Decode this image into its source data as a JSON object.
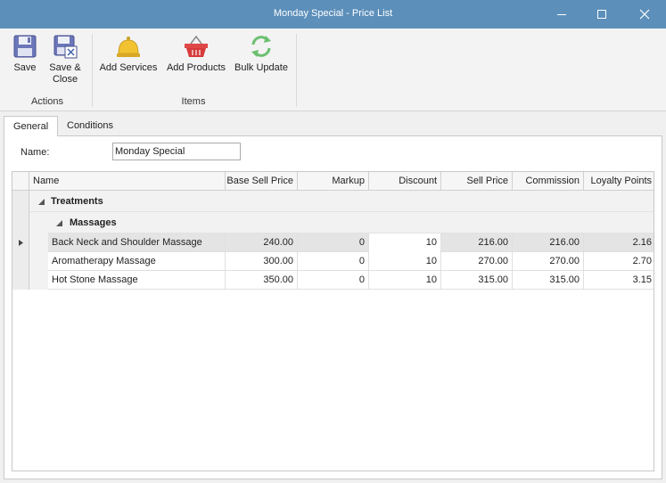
{
  "window": {
    "title": "Monday Special - Price List",
    "controls": [
      "minimize-icon",
      "maximize-icon",
      "close-icon"
    ]
  },
  "ribbon": {
    "groups": [
      {
        "label": "Actions",
        "buttons": [
          {
            "label": "Save",
            "icon": "floppy-disk-icon"
          },
          {
            "label_line1": "Save &",
            "label_line2": "Close",
            "icon": "save-close-icon"
          }
        ]
      },
      {
        "label": "Items",
        "buttons": [
          {
            "label": "Add Services",
            "icon": "service-bell-icon"
          },
          {
            "label": "Add Products",
            "icon": "shopping-basket-icon"
          },
          {
            "label": "Bulk Update",
            "icon": "refresh-icon"
          }
        ]
      }
    ]
  },
  "tabs": [
    {
      "label": "General",
      "active": true
    },
    {
      "label": "Conditions",
      "active": false
    }
  ],
  "form": {
    "name_label": "Name:",
    "name_value": "Monday Special"
  },
  "grid": {
    "columns": [
      "Name",
      "Base Sell Price",
      "Markup",
      "Discount",
      "Sell Price",
      "Commission",
      "Loyalty Points"
    ],
    "group": "Treatments",
    "subgroup": "Massages",
    "rows": [
      {
        "name": "Back Neck and Shoulder Massage",
        "base": "240.00",
        "markup": "0",
        "discount": "10",
        "sell": "216.00",
        "commission": "216.00",
        "loyalty": "2.16"
      },
      {
        "name": "Aromatherapy Massage",
        "base": "300.00",
        "markup": "0",
        "discount": "10",
        "sell": "270.00",
        "commission": "270.00",
        "loyalty": "2.70"
      },
      {
        "name": "Hot Stone Massage",
        "base": "350.00",
        "markup": "0",
        "discount": "10",
        "sell": "315.00",
        "commission": "315.00",
        "loyalty": "3.15"
      }
    ]
  },
  "colors": {
    "titlebar": "#5c8fba",
    "selected_row": "#e4e4e4"
  }
}
